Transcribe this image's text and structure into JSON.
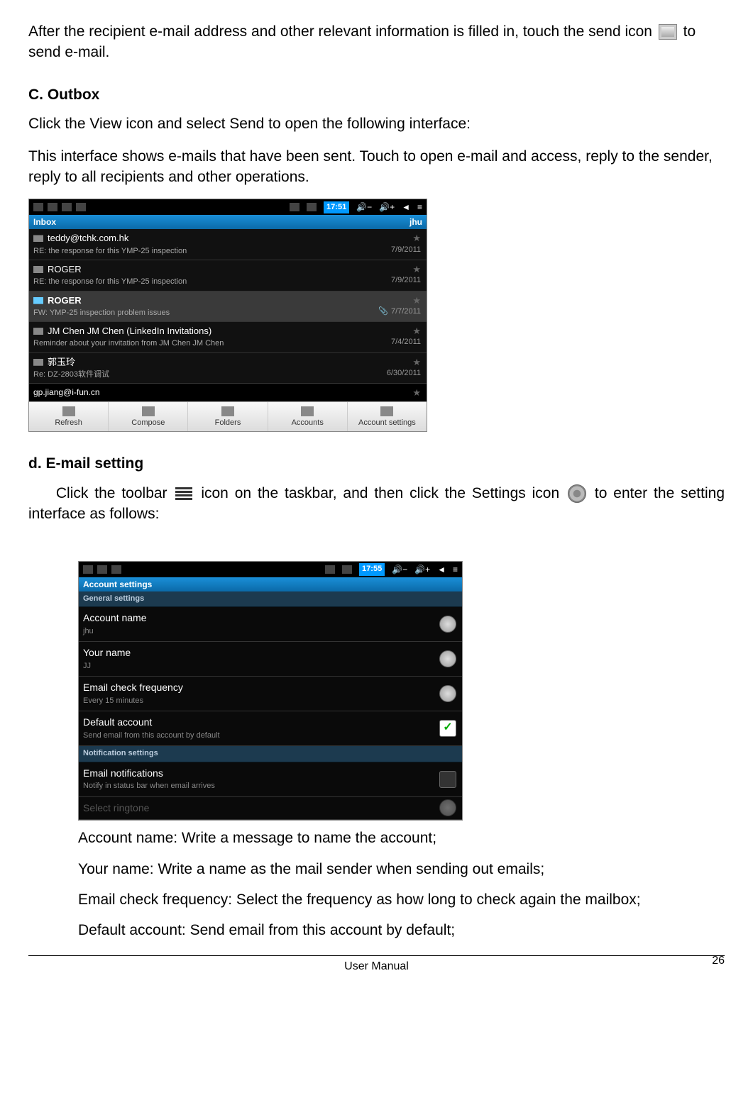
{
  "intro": {
    "line1a": "After the recipient e-mail address and other relevant information is filled in, touch the send icon",
    "line1b": " to send e-mail."
  },
  "sectionC": {
    "title": "C. Outbox",
    "p1": "Click the View icon and select Send to open the following interface:",
    "p2": "This interface shows e-mails that have been sent. Touch to open e-mail and access, reply to the sender, reply to all recipients and other operations."
  },
  "shot1": {
    "time": "17:51",
    "vol_minus": "−",
    "vol_plus": "+",
    "header_left": "Inbox",
    "header_right": "jhu",
    "rows": [
      {
        "sender": "teddy@tchk.com.hk",
        "subj": "RE: the response for this YMP-25 inspection",
        "date": "7/9/2011",
        "sel": false
      },
      {
        "sender": "ROGER",
        "subj": "RE: the response for this YMP-25 inspection",
        "date": "7/9/2011",
        "sel": false
      },
      {
        "sender": "ROGER",
        "subj": "FW: YMP-25 inspection problem issues",
        "date": "7/7/2011",
        "sel": true,
        "clip": true
      },
      {
        "sender": "JM Chen JM Chen (LinkedIn Invitations)",
        "subj": "Reminder about your invitation from JM Chen JM Chen",
        "date": "7/4/2011",
        "sel": false
      },
      {
        "sender": "郭玉玲",
        "subj": "Re: DZ-2803软件调试",
        "date": "6/30/2011",
        "sel": false
      }
    ],
    "partial": "gp.jiang@i-fun.cn",
    "toolbar": [
      "Refresh",
      "Compose",
      "Folders",
      "Accounts",
      "Account settings"
    ]
  },
  "sectionD": {
    "title": "d. E-mail setting",
    "line_a": "Click the toolbar ",
    "line_b": " icon on the taskbar, and then click the Settings icon ",
    "line_c": " to enter the setting interface as follows:"
  },
  "shot2": {
    "time": "17:55",
    "header": "Account settings",
    "gs": "General settings",
    "rows": [
      {
        "t": "Account name",
        "s": "jhu",
        "ctrl": "arrow"
      },
      {
        "t": "Your name",
        "s": "JJ",
        "ctrl": "arrow"
      },
      {
        "t": "Email check frequency",
        "s": "Every 15 minutes",
        "ctrl": "arrow"
      },
      {
        "t": "Default account",
        "s": "Send email from this account by default",
        "ctrl": "check_on"
      }
    ],
    "ns": "Notification settings",
    "rows2": [
      {
        "t": "Email notifications",
        "s": "Notify in status bar when email arrives",
        "ctrl": "check_off"
      },
      {
        "t": "Select ringtone",
        "s": "",
        "ctrl": "arrow",
        "dim": true
      }
    ]
  },
  "bullets": {
    "b1": "Account name: Write a message to name the account;",
    "b2": "Your name: Write a name as the mail sender when sending out emails;",
    "b3": "Email check frequency: Select the frequency as how long to check again the mailbox;",
    "b4": "Default account: Send email from this account by default;"
  },
  "footer": {
    "center": "User Manual",
    "page": "26"
  }
}
